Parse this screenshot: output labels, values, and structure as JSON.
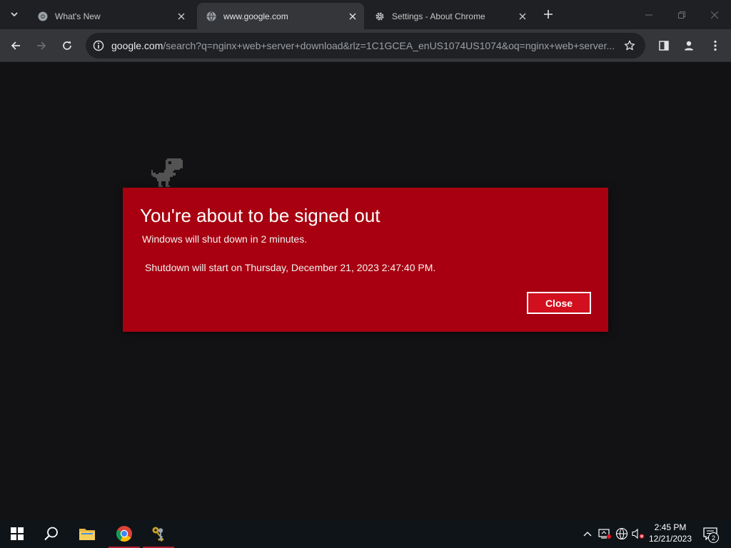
{
  "browser": {
    "tabs": [
      {
        "title": "What's New",
        "icon": "chrome-icon",
        "active": false
      },
      {
        "title": "www.google.com",
        "icon": "globe-icon",
        "active": true
      },
      {
        "title": "Settings - About Chrome",
        "icon": "gear-icon",
        "active": false
      }
    ],
    "address_host": "google.com",
    "address_rest": "/search?q=nginx+web+server+download&rlz=1C1GCEA_enUS1074US1074&oq=nginx+web+server..."
  },
  "dialog": {
    "title": "You're about to be signed out",
    "message": "Windows will shut down in 2 minutes.",
    "detail": "Shutdown will start on Thursday, December 21, 2023 2:47:40 PM.",
    "close_label": "Close"
  },
  "taskbar": {
    "time": "2:45 PM",
    "date": "12/21/2023",
    "notification_count": "2"
  },
  "colors": {
    "dialog_bg": "#a80010",
    "button_bg": "#d20f1f",
    "page_bg": "#121214"
  }
}
